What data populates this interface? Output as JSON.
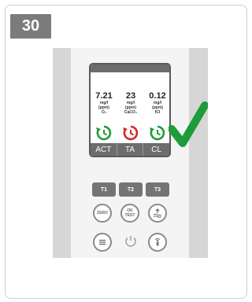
{
  "step": {
    "number": "30"
  },
  "device": {
    "readings": [
      {
        "value": "7.21",
        "unit_lines": [
          "mg/l",
          "(ppm)",
          "O₂"
        ]
      },
      {
        "value": "23",
        "unit_lines": [
          "mg/l",
          "(ppm)",
          "CaCO₃"
        ]
      },
      {
        "value": "0.12",
        "unit_lines": [
          "mg/l",
          "(ppm)",
          "fCl"
        ]
      }
    ],
    "timer_icons": [
      "timer-icon-green",
      "timer-icon-red",
      "timer-icon-green"
    ],
    "tabs": [
      "ACT",
      "TA",
      "CL"
    ],
    "buttons": {
      "t1": "T1",
      "t2": "T2",
      "t3": "T3",
      "zero": "ZERO",
      "ok": "OK",
      "test": "TEST"
    }
  },
  "colors": {
    "green": "#1e9c3a",
    "red": "#d62626",
    "screen_bar": "#6d6d6d",
    "button": "#747474"
  }
}
